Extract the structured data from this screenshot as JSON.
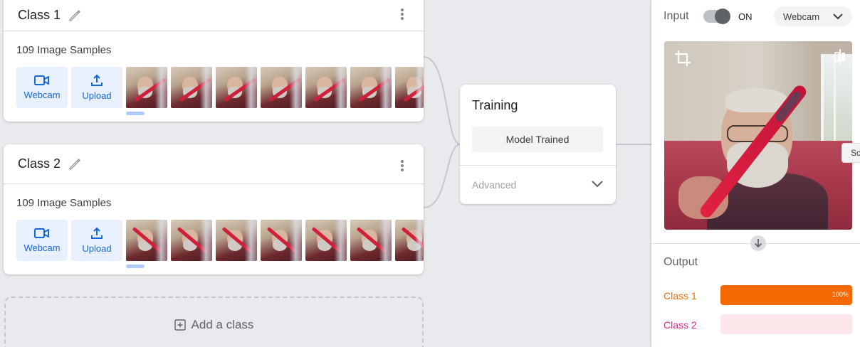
{
  "classes": [
    {
      "title": "Class 1",
      "samples_label": "109 Image Samples",
      "webcam_label": "Webcam",
      "upload_label": "Upload"
    },
    {
      "title": "Class 2",
      "samples_label": "109 Image Samples",
      "webcam_label": "Webcam",
      "upload_label": "Upload"
    }
  ],
  "add_class_label": "Add a class",
  "training": {
    "title": "Training",
    "model_button": "Model Trained",
    "advanced_label": "Advanced"
  },
  "preview": {
    "input_label": "Input",
    "toggle_state": "ON",
    "source_select": "Webcam",
    "side_tab_text": "Sc",
    "output_label": "Output",
    "outputs": [
      {
        "name": "Class 1",
        "percent_label": "100%",
        "fraction": 1.0,
        "color": "#f46a00",
        "bg": "#fde3d0"
      },
      {
        "name": "Class 2",
        "percent_label": "",
        "fraction": 0.0,
        "color": "#e52592",
        "bg": "#fde7ea"
      }
    ]
  },
  "colors": {
    "accent_blue": "#1967d2",
    "button_bg": "#e8f0fe",
    "class1": "#e8710a",
    "class2": "#e52592"
  }
}
